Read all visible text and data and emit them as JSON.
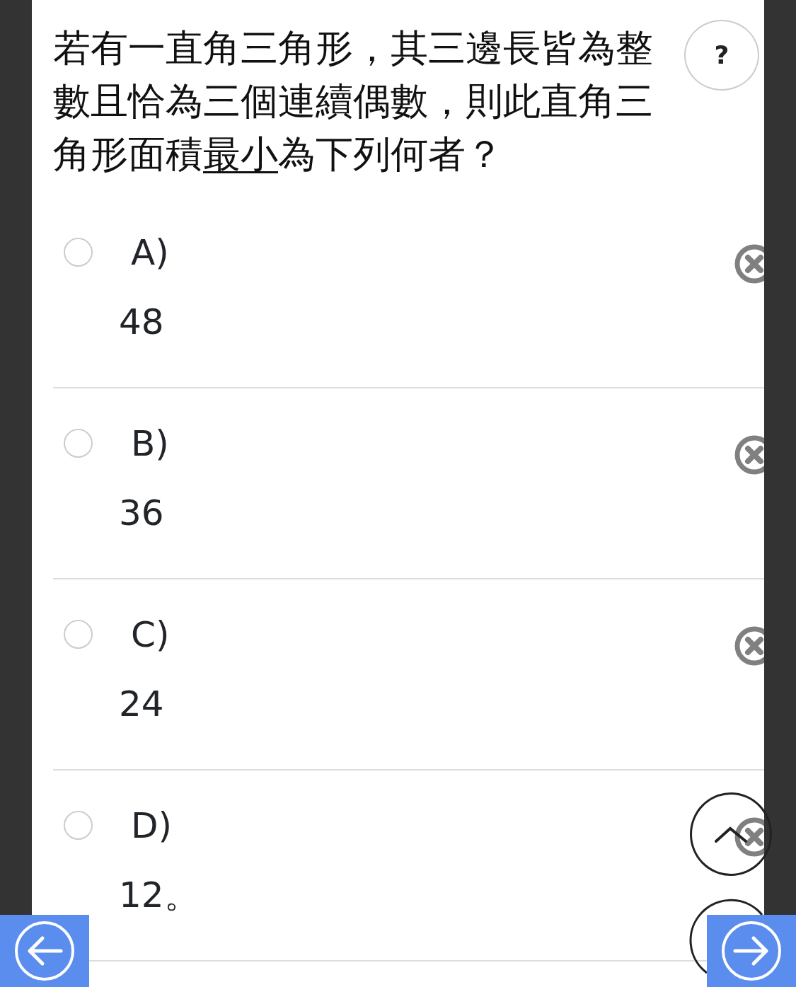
{
  "question": {
    "segments": [
      {
        "text": "若有一直角三角形，其三邊長皆為整數且恰為三個連續偶數，則此直角三角形面積",
        "underline": false
      },
      {
        "text": "最小",
        "underline": true
      },
      {
        "text": "為下列何者？",
        "underline": false
      }
    ]
  },
  "help_button": {
    "label": "?"
  },
  "options": [
    {
      "letter": "A)",
      "value": "48",
      "selected": false
    },
    {
      "letter": "B)",
      "value": "36",
      "selected": false
    },
    {
      "letter": "C)",
      "value": "24",
      "selected": false
    },
    {
      "letter": "D)",
      "value": "12。",
      "selected": false
    }
  ]
}
